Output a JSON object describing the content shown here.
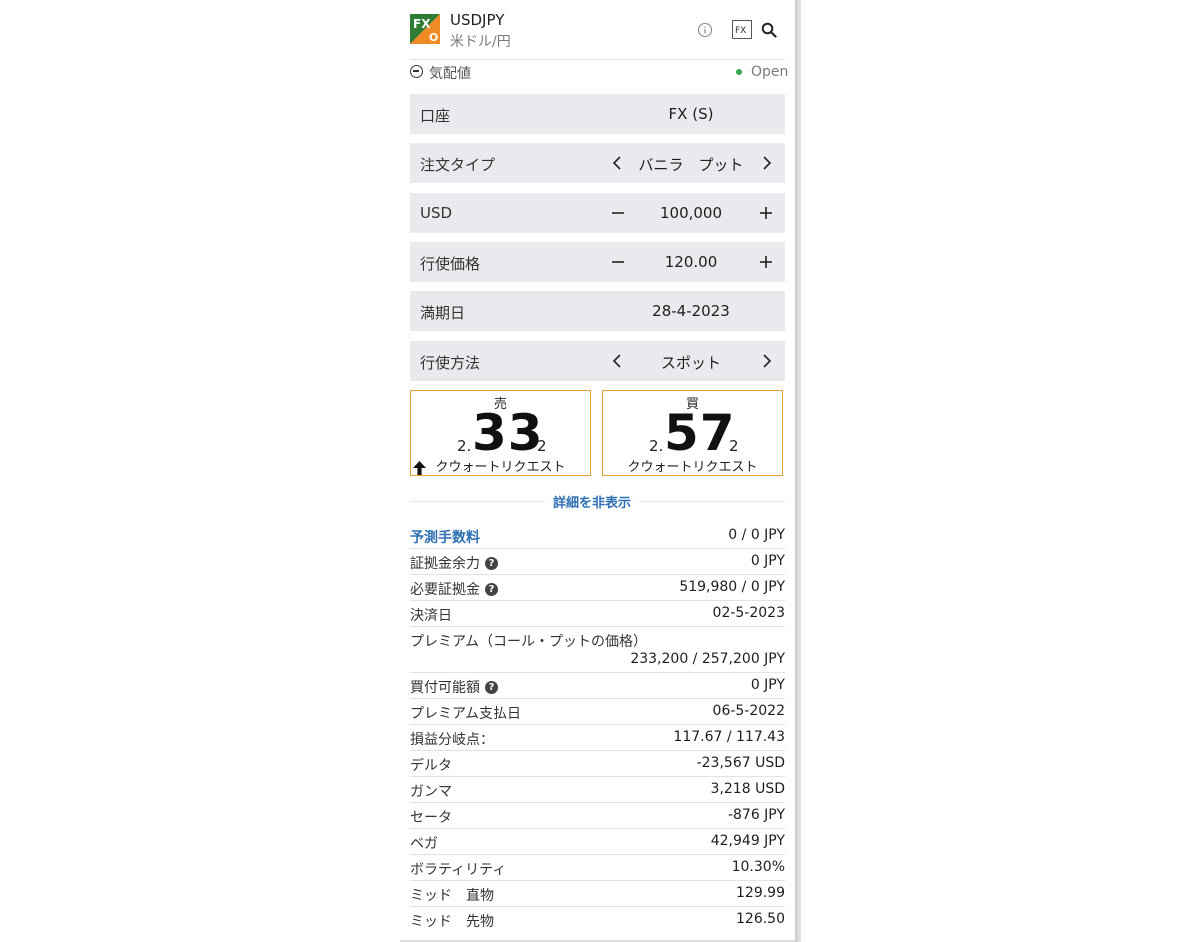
{
  "header": {
    "logo_top": "FX",
    "logo_bottom": "O",
    "symbol": "USDJPY",
    "subname": "米ドル/円",
    "icons": [
      "info-icon",
      "fx-icon",
      "search-icon"
    ],
    "fx_icon_text": "FX"
  },
  "quotes": {
    "label": "気配値",
    "status": "Open",
    "status_color": "#3aa655"
  },
  "form": {
    "account": {
      "label": "口座",
      "value": "FX (S)"
    },
    "order_type": {
      "label": "注文タイプ",
      "value": "バニラ　プット"
    },
    "amount": {
      "label": "USD",
      "value": "100,000"
    },
    "strike": {
      "label": "行使価格",
      "value": "120.00"
    },
    "expiry": {
      "label": "満期日",
      "value": "28-4-2023"
    },
    "exercise": {
      "label": "行使方法",
      "value": "スポット"
    }
  },
  "sell": {
    "side": "売",
    "prefix": "2.",
    "big": "33",
    "suffix": "2",
    "request": "クウォートリクエスト"
  },
  "buy": {
    "side": "買",
    "prefix": "2.",
    "big": "57",
    "suffix": "2",
    "request": "クウォートリクエスト"
  },
  "details_toggle": "詳細を非表示",
  "details": [
    {
      "label": "予測手数料",
      "value": "0 / 0 JPY",
      "link": true
    },
    {
      "label": "証拠金余力",
      "value": "0 JPY",
      "help": true
    },
    {
      "label": "必要証拠金",
      "value": "519,980 / 0 JPY",
      "help": true
    },
    {
      "label": "決済日",
      "value": "02-5-2023"
    },
    {
      "label": "プレミアム（コール・プットの価格）",
      "value": "233,200 / 257,200 JPY"
    },
    {
      "label": "買付可能額",
      "value": "0 JPY",
      "help": true
    },
    {
      "label": "プレミアム支払日",
      "value": "06-5-2022"
    },
    {
      "label": "損益分岐点：",
      "value": "117.67 / 117.43"
    },
    {
      "label": "デルタ",
      "value": "-23,567 USD"
    },
    {
      "label": "ガンマ",
      "value": "3,218 USD"
    },
    {
      "label": "セータ",
      "value": "-876 JPY"
    },
    {
      "label": "ベガ",
      "value": "42,949 JPY"
    },
    {
      "label": "ボラティリティ",
      "value": "10.30%"
    },
    {
      "label": "ミッド　直物",
      "value": "129.99"
    },
    {
      "label": "ミッド　先物",
      "value": "126.50"
    }
  ],
  "help_glyph": "?",
  "colors": {
    "accent": "#e89c3a",
    "link": "#2f6fb3",
    "row_bg": "#e8eaed",
    "logo_green": "#2e7d32",
    "logo_orange": "#f08a24"
  }
}
